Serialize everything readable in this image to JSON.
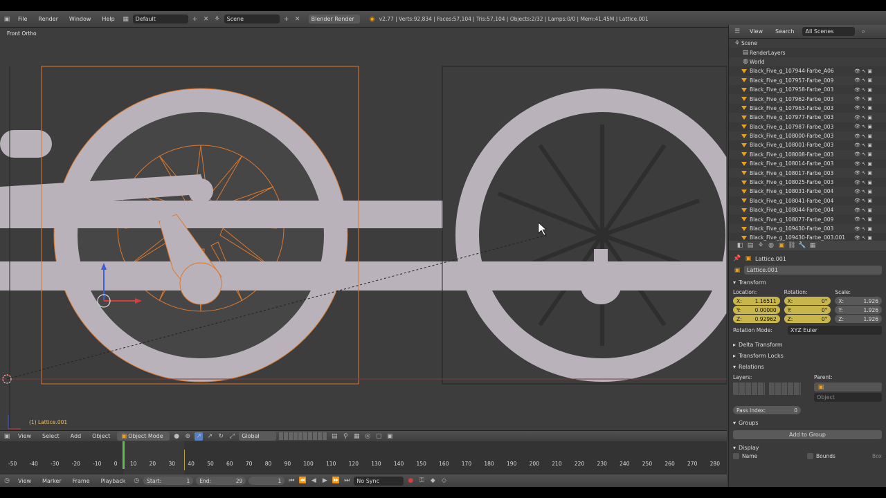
{
  "info_header": {
    "menus": [
      "File",
      "Render",
      "Window",
      "Help"
    ],
    "screen_layout": "Default",
    "scene": "Scene",
    "render_engine": "Blender Render",
    "stats": "v2.77 | Verts:92,834 | Faces:57,104 | Tris:57,104 | Objects:2/32 | Lamps:0/0 | Mem:41.45M | Lattice.001"
  },
  "viewport": {
    "view_name": "Front Ortho",
    "object_label": "(1) Lattice.001"
  },
  "outliner": {
    "menus": [
      "View",
      "Search"
    ],
    "filter": "All Scenes",
    "scene": "Scene",
    "render_layers": "RenderLayers",
    "world": "World",
    "items": [
      "Black_Five_g_107944-Farbe_A06",
      "Black_Five_g_107957-Farbe_009",
      "Black_Five_g_107958-Farbe_003",
      "Black_Five_g_107962-Farbe_003",
      "Black_Five_g_107963-Farbe_003",
      "Black_Five_g_107977-Farbe_003",
      "Black_Five_g_107987-Farbe_003",
      "Black_Five_g_108000-Farbe_003",
      "Black_Five_g_108001-Farbe_003",
      "Black_Five_g_108008-Farbe_003",
      "Black_Five_g_108014-Farbe_003",
      "Black_Five_g_108017-Farbe_003",
      "Black_Five_g_108025-Farbe_003",
      "Black_Five_g_108031-Farbe_004",
      "Black_Five_g_108041-Farbe_004",
      "Black_Five_g_108044-Farbe_004",
      "Black_Five_g_108077-Farbe_009",
      "Black_Five_g_109430-Farbe_003",
      "Black_Five_g_109430-Farbe_003.001"
    ]
  },
  "properties": {
    "context": "Lattice.001",
    "object_name": "Lattice.001",
    "transform_title": "Transform",
    "location_label": "Location:",
    "rotation_label": "Rotation:",
    "scale_label": "Scale:",
    "location": [
      {
        "axis": "X:",
        "value": "1.16511"
      },
      {
        "axis": "Y:",
        "value": "0.00000"
      },
      {
        "axis": "Z:",
        "value": "0.92962"
      }
    ],
    "rotation": [
      {
        "axis": "X:",
        "value": "0°"
      },
      {
        "axis": "Y:",
        "value": "0°"
      },
      {
        "axis": "Z:",
        "value": "0°"
      }
    ],
    "scale": [
      {
        "axis": "X:",
        "value": "1.926"
      },
      {
        "axis": "Y:",
        "value": "1.926"
      },
      {
        "axis": "Z:",
        "value": "1.926"
      }
    ],
    "rotation_mode_label": "Rotation Mode:",
    "rotation_mode": "XYZ Euler",
    "delta_transform": "Delta Transform",
    "transform_locks": "Transform Locks",
    "relations": "Relations",
    "layers_label": "Layers:",
    "parent_label": "Parent:",
    "parent_type": "Object",
    "pass_index_label": "Pass Index:",
    "pass_index": "0",
    "groups": "Groups",
    "add_to_group": "Add to Group",
    "display": "Display",
    "name_label": "Name",
    "bounds_label": "Bounds",
    "bounds_type": "Box"
  },
  "view3d_header": {
    "menus": [
      "View",
      "Select",
      "Add",
      "Object"
    ],
    "mode": "Object Mode",
    "orientation": "Global"
  },
  "timeline": {
    "ticks": [
      "-50",
      "-40",
      "-30",
      "-20",
      "-10",
      "0",
      "10",
      "20",
      "30",
      "40",
      "50",
      "60",
      "70",
      "80",
      "90",
      "100",
      "110",
      "120",
      "130",
      "140",
      "150",
      "160",
      "170",
      "180",
      "190",
      "200",
      "210",
      "220",
      "230",
      "240",
      "250",
      "260",
      "270",
      "280"
    ],
    "menus": [
      "View",
      "Marker",
      "Frame",
      "Playback"
    ],
    "start_label": "Start:",
    "start": "1",
    "end_label": "End:",
    "end": "29",
    "current": "1",
    "sync": "No Sync"
  }
}
